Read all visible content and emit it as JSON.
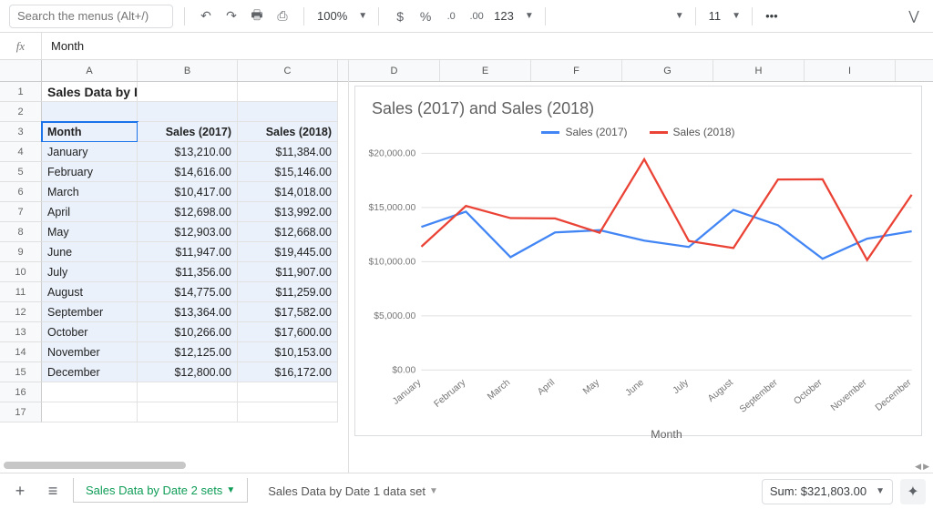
{
  "toolbar": {
    "search_placeholder": "Search the menus (Alt+/)",
    "zoom": "100%",
    "currency": "$",
    "percent": "%",
    "dec_dec": ".0",
    "inc_dec": ".00",
    "num_format": "123",
    "font_size": "11",
    "more": "•••"
  },
  "formula_bar": {
    "fx": "fx",
    "value": "Month"
  },
  "columns_left": [
    "A",
    "B",
    "C"
  ],
  "columns_right": [
    "D",
    "E",
    "F",
    "G",
    "H",
    "I"
  ],
  "title_cell": "Sales Data by Date",
  "table": {
    "headers": [
      "Month",
      "Sales (2017)",
      "Sales (2018)"
    ],
    "rows": [
      {
        "m": "January",
        "a": "$13,210.00",
        "b": "$11,384.00"
      },
      {
        "m": "February",
        "a": "$14,616.00",
        "b": "$15,146.00"
      },
      {
        "m": "March",
        "a": "$10,417.00",
        "b": "$14,018.00"
      },
      {
        "m": "April",
        "a": "$12,698.00",
        "b": "$13,992.00"
      },
      {
        "m": "May",
        "a": "$12,903.00",
        "b": "$12,668.00"
      },
      {
        "m": "June",
        "a": "$11,947.00",
        "b": "$19,445.00"
      },
      {
        "m": "July",
        "a": "$11,356.00",
        "b": "$11,907.00"
      },
      {
        "m": "August",
        "a": "$14,775.00",
        "b": "$11,259.00"
      },
      {
        "m": "September",
        "a": "$13,364.00",
        "b": "$17,582.00"
      },
      {
        "m": "October",
        "a": "$10,266.00",
        "b": "$17,600.00"
      },
      {
        "m": "November",
        "a": "$12,125.00",
        "b": "$10,153.00"
      },
      {
        "m": "December",
        "a": "$12,800.00",
        "b": "$16,172.00"
      }
    ]
  },
  "chart": {
    "title": "Sales (2017) and Sales (2018)",
    "legend": [
      "Sales (2017)",
      "Sales (2018)"
    ],
    "colors": {
      "s1": "#4285f4",
      "s2": "#ea4335"
    },
    "xlabel": "Month",
    "y_ticks": [
      "$0.00",
      "$5,000.00",
      "$10,000.00",
      "$15,000.00",
      "$20,000.00"
    ]
  },
  "chart_data": {
    "type": "line",
    "title": "Sales (2017) and Sales (2018)",
    "xlabel": "Month",
    "ylabel": "",
    "ylim": [
      0,
      20000
    ],
    "categories": [
      "January",
      "February",
      "March",
      "April",
      "May",
      "June",
      "July",
      "August",
      "September",
      "October",
      "November",
      "December"
    ],
    "series": [
      {
        "name": "Sales (2017)",
        "color": "#4285f4",
        "values": [
          13210,
          14616,
          10417,
          12698,
          12903,
          11947,
          11356,
          14775,
          13364,
          10266,
          12125,
          12800
        ]
      },
      {
        "name": "Sales (2018)",
        "color": "#ea4335",
        "values": [
          11384,
          15146,
          14018,
          13992,
          12668,
          19445,
          11907,
          11259,
          17582,
          17600,
          10153,
          16172
        ]
      }
    ]
  },
  "tabs": {
    "active": "Sales Data by Date 2 sets",
    "inactive": "Sales Data by Date 1 data set"
  },
  "status": {
    "sum": "Sum: $321,803.00"
  }
}
